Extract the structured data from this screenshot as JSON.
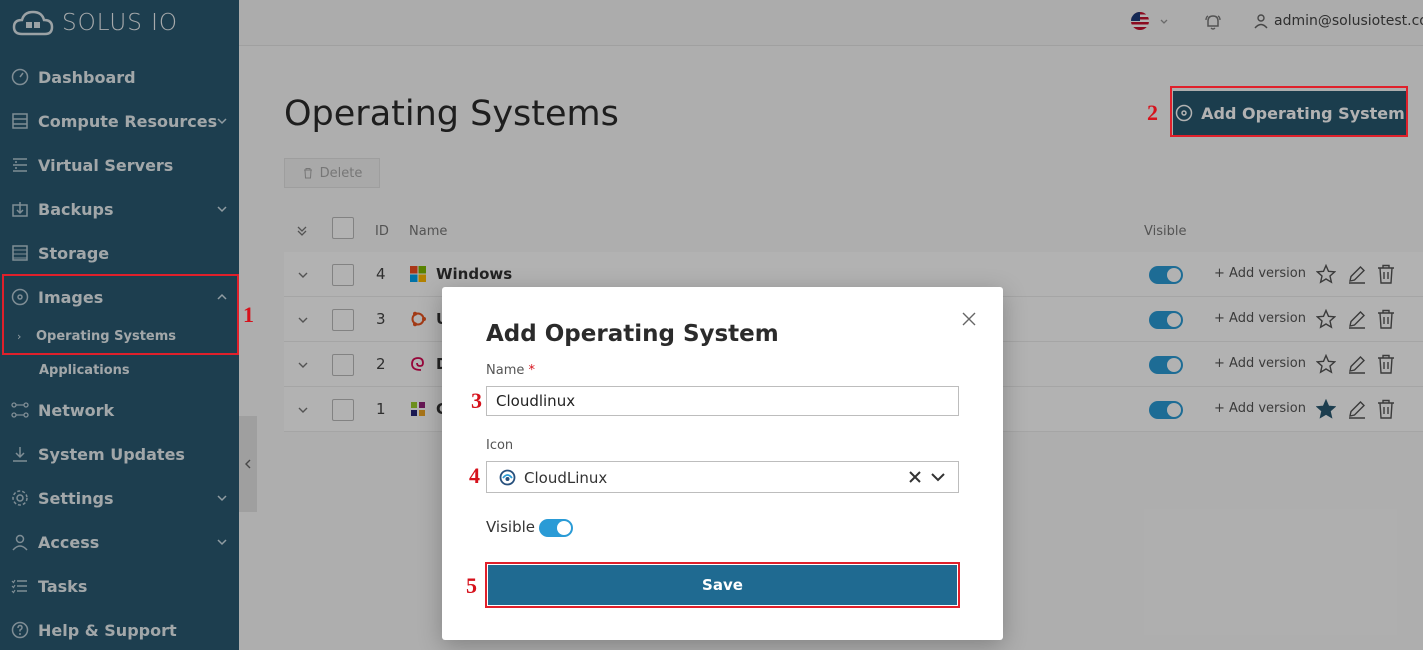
{
  "app": {
    "logo_text": "SOLUS IO"
  },
  "sidebar": {
    "items": [
      {
        "label": "Dashboard"
      },
      {
        "label": "Compute Resources"
      },
      {
        "label": "Virtual Servers"
      },
      {
        "label": "Backups"
      },
      {
        "label": "Storage"
      },
      {
        "label": "Images"
      },
      {
        "label": "Network"
      },
      {
        "label": "System Updates"
      },
      {
        "label": "Settings"
      },
      {
        "label": "Access"
      },
      {
        "label": "Tasks"
      },
      {
        "label": "Help & Support"
      }
    ],
    "images_sub": [
      {
        "label": "Operating Systems"
      },
      {
        "label": "Applications"
      }
    ]
  },
  "topbar": {
    "user": "admin@solusiotest.com"
  },
  "page": {
    "title": "Operating Systems",
    "add_button": "Add Operating System",
    "delete_button": "Delete"
  },
  "table": {
    "headers": {
      "id": "ID",
      "name": "Name",
      "visible": "Visible"
    },
    "add_version_label": "+ Add version",
    "rows": [
      {
        "id": "4",
        "name": "Windows",
        "icon": "windows-logo",
        "visible": true,
        "default": false
      },
      {
        "id": "3",
        "name": "U",
        "icon": "ubuntu-logo",
        "visible": true,
        "default": false
      },
      {
        "id": "2",
        "name": "D",
        "icon": "debian-logo",
        "visible": true,
        "default": false
      },
      {
        "id": "1",
        "name": "C",
        "icon": "centos-logo",
        "visible": true,
        "default": true
      }
    ]
  },
  "modal": {
    "title": "Add Operating System",
    "name_label": "Name",
    "name_required": "*",
    "name_value": "Cloudlinux",
    "icon_label": "Icon",
    "icon_value": "CloudLinux",
    "visible_label": "Visible",
    "visible": true,
    "save_label": "Save"
  },
  "annotations": [
    "1",
    "2",
    "3",
    "4",
    "5"
  ],
  "colors": {
    "sidebar": "#2a5971",
    "primary_button": "#28586f",
    "save_button": "#1f6a91",
    "toggle_on": "#2a9bd6",
    "callout": "#e0202b"
  }
}
